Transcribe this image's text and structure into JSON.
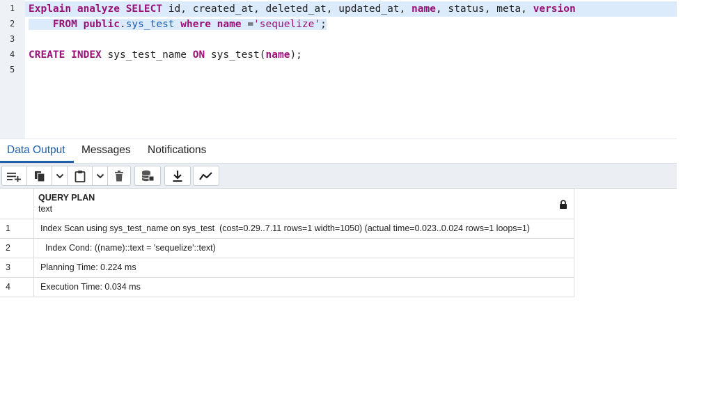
{
  "editor": {
    "line_numbers": [
      "1",
      "2",
      "3",
      "4",
      "5"
    ],
    "line1": {
      "explain": "Explain",
      "analyze": "analyze",
      "select": "SELECT",
      "cols_a": " id, created_at, deleted_at, updated_at, ",
      "name": "name",
      "cols_b": ", status, meta, ",
      "version": "version"
    },
    "line2": {
      "indent": "    ",
      "from": "FROM",
      "public": "public",
      "dot": ".",
      "table": "sys_test",
      "where": "where",
      "name": "name",
      "eq": " =",
      "value": "'sequelize'",
      "semi": ";"
    },
    "line4": {
      "create": "CREATE",
      "index": "INDEX",
      "idx_name": " sys_test_name ",
      "on": "ON",
      "table": " sys_test(",
      "name": "name",
      "close": ");"
    }
  },
  "tabs": [
    {
      "label": "Data Output",
      "active": true
    },
    {
      "label": "Messages",
      "active": false
    },
    {
      "label": "Notifications",
      "active": false
    }
  ],
  "toolbar": {
    "icons": [
      "add-row-icon",
      "copy-icon",
      "chevron-down-icon",
      "paste-icon",
      "chevron-down-icon",
      "delete-icon",
      "save-data-icon",
      "download-icon",
      "graph-icon"
    ]
  },
  "grid": {
    "column": {
      "name": "QUERY PLAN",
      "type": "text",
      "locked": true
    },
    "rows": [
      {
        "idx": "1",
        "value": "Index Scan using sys_test_name on sys_test  (cost=0.29..7.11 rows=1 width=1050) (actual time=0.023..0.024 rows=1 loops=1)"
      },
      {
        "idx": "2",
        "value": "  Index Cond: ((name)::text = 'sequelize'::text)"
      },
      {
        "idx": "3",
        "value": "Planning Time: 0.224 ms"
      },
      {
        "idx": "4",
        "value": "Execution Time: 0.034 ms"
      }
    ]
  },
  "colors": {
    "keyword": "#9a1078",
    "identifier": "#1a60b8",
    "active_tab": "#1f5fa8",
    "selection": "#dcebfb"
  }
}
